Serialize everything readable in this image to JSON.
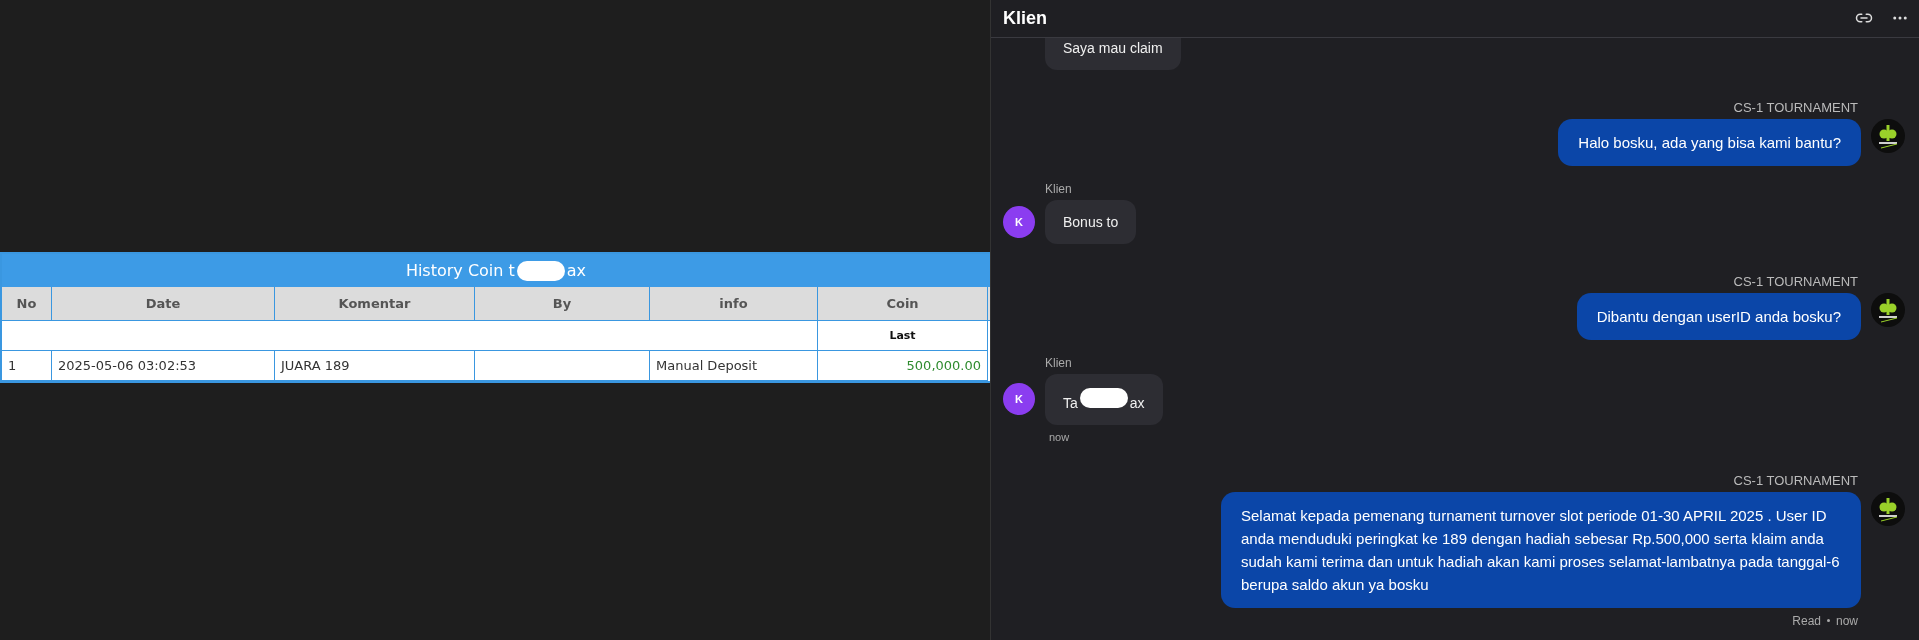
{
  "table": {
    "title_parts": [
      "History Coin t",
      "ax"
    ],
    "columns": [
      "No",
      "Date",
      "Komentar",
      "By",
      "info",
      "Coin"
    ],
    "subheader": "Last",
    "rows": [
      {
        "no": "1",
        "date": "2025-05-06 03:02:53",
        "komentar": "JUARA 189",
        "info": "Manual Deposit",
        "coin": "500,000.00"
      }
    ]
  },
  "chat": {
    "title": "Klien",
    "messages": [
      {
        "kind": "incoming",
        "text_parts": [
          "Saya mau claim"
        ]
      },
      {
        "kind": "outgoing",
        "sender": "CS-1 TOURNAMENT",
        "text_parts": [
          "Halo bosku, ada yang bisa kami bantu?"
        ]
      },
      {
        "kind": "incoming",
        "sender": "Klien",
        "avatar": "K",
        "text_parts": [
          "Bonus to"
        ]
      },
      {
        "kind": "outgoing",
        "sender": "CS-1 TOURNAMENT",
        "text_parts": [
          "Dibantu dengan userID anda bosku?"
        ]
      },
      {
        "kind": "incoming",
        "sender": "Klien",
        "avatar": "K",
        "text_parts": [
          "Ta",
          "ax"
        ],
        "time": "now"
      },
      {
        "kind": "outgoing",
        "sender": "CS-1 TOURNAMENT",
        "text_parts": [
          "Selamat kepada pemenang turnament turnover slot periode 01-30 APRIL 2025 . User ID anda menduduki peringkat ke 189 dengan hadiah sebesar Rp.500,000 serta klaim anda sudah kami terima dan untuk hadiah akan kami proses selamat-lambatnya pada tanggal-6 berupa saldo akun ya bosku"
        ],
        "status": "Read",
        "time": "now"
      }
    ]
  }
}
